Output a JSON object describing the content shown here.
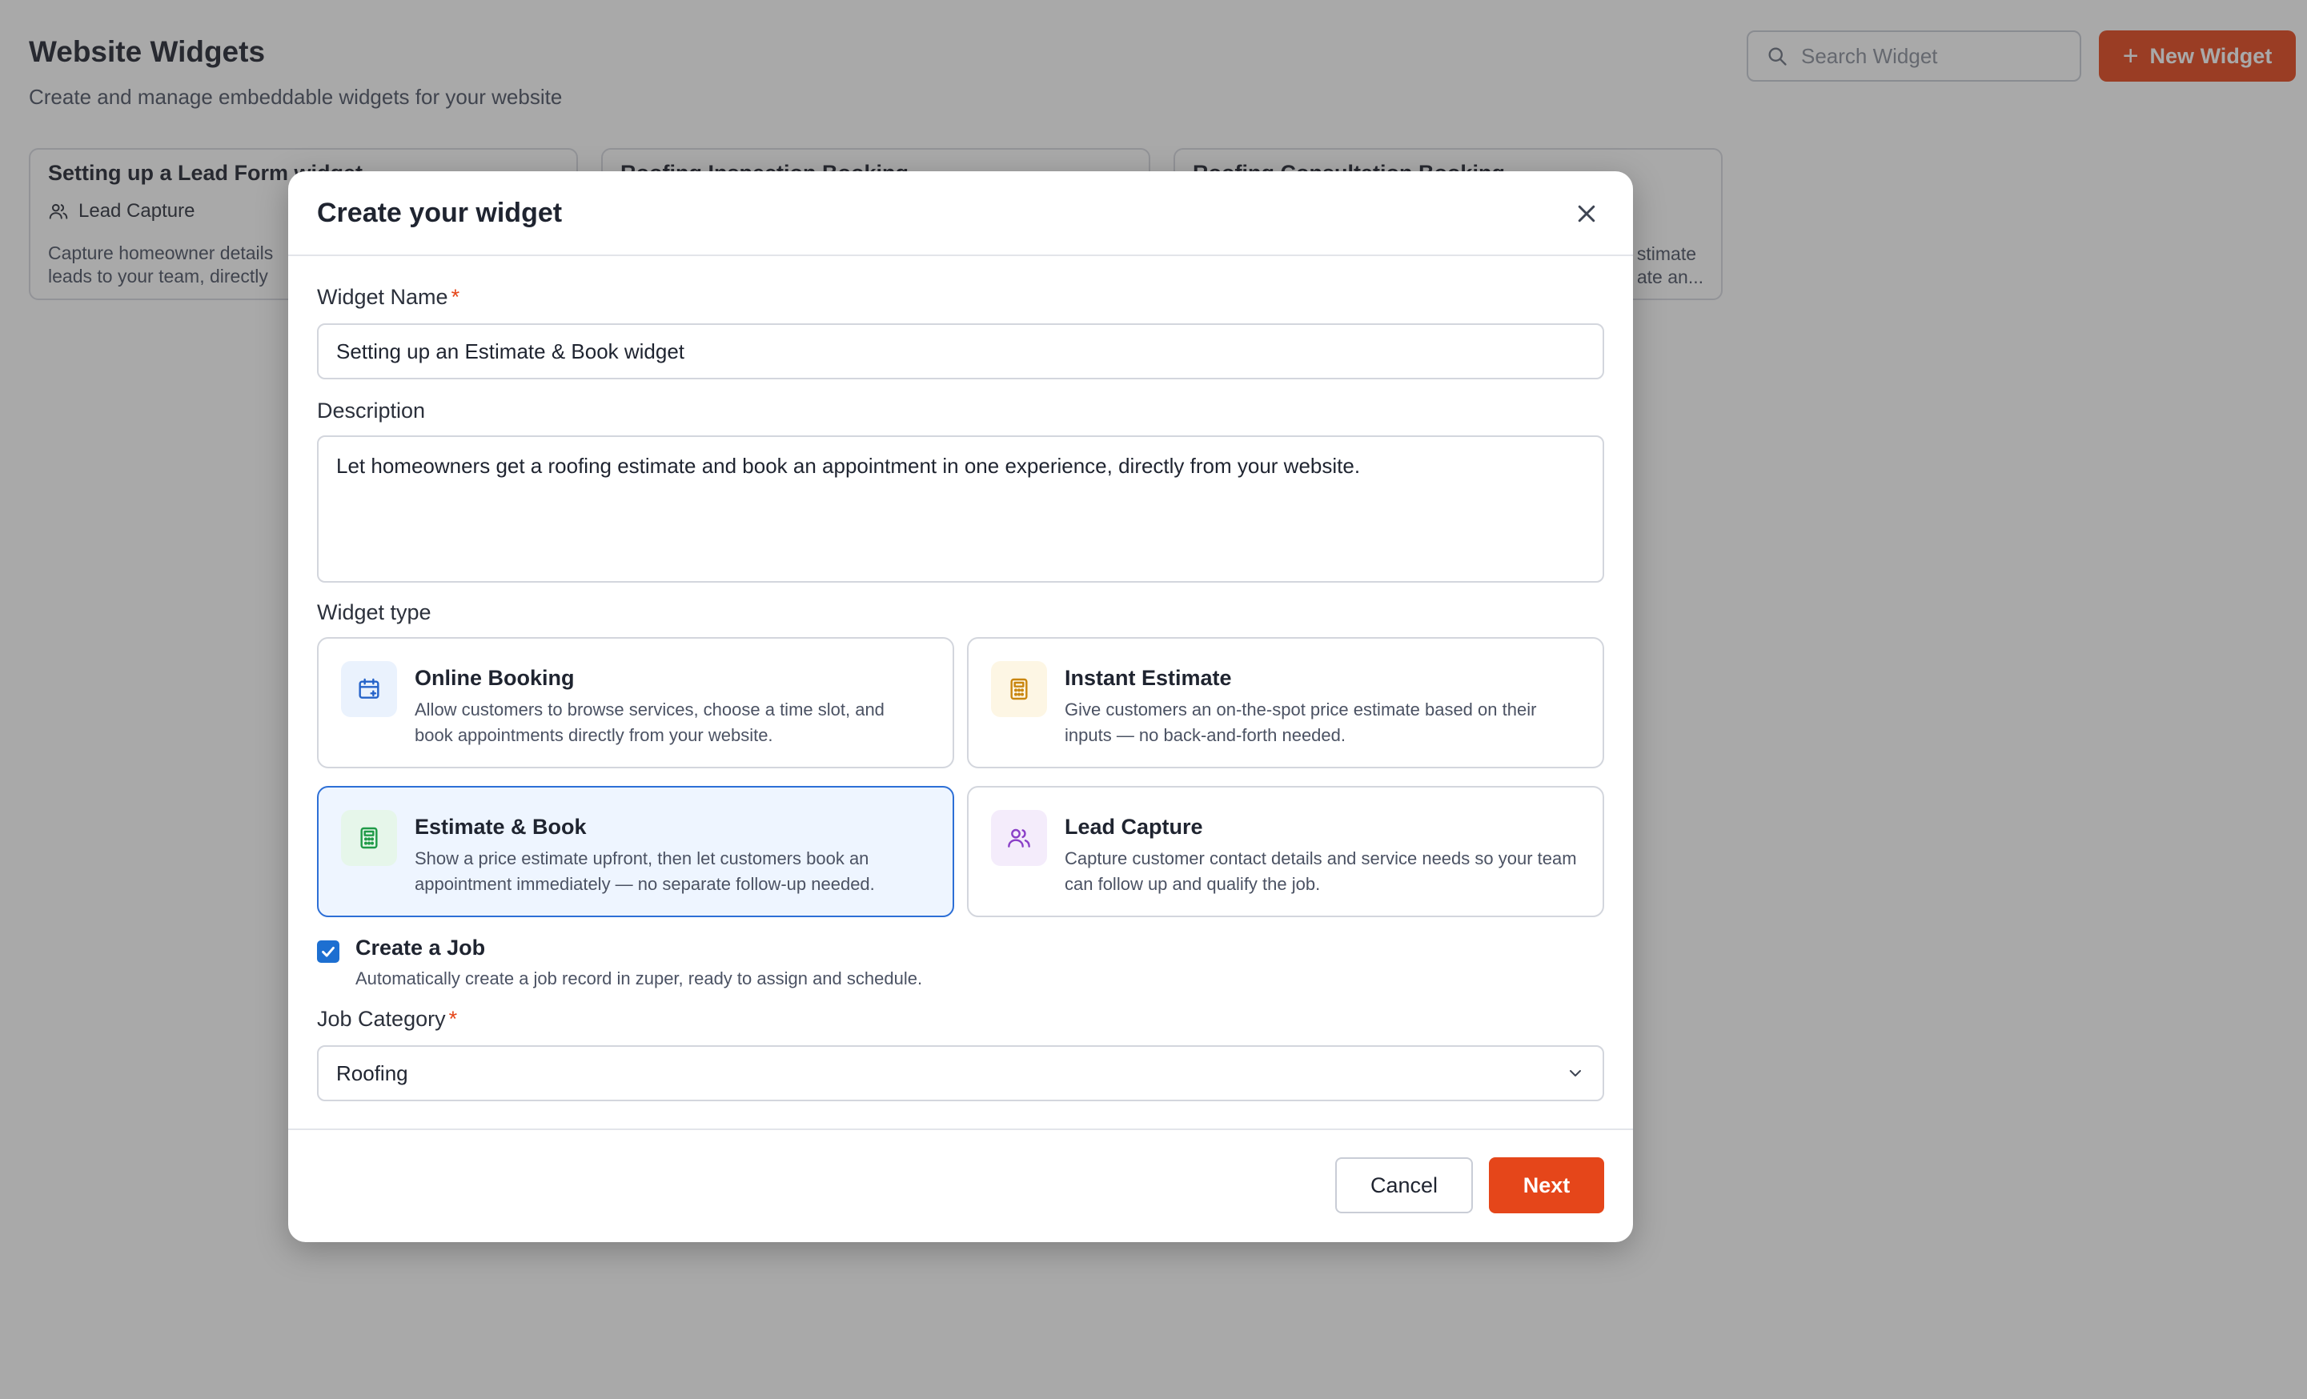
{
  "page": {
    "title": "Website Widgets",
    "subtitle": "Create and manage embeddable widgets for your website",
    "search_placeholder": "Search Widget",
    "new_widget_label": "New Widget",
    "cards": [
      {
        "title": "Setting up a Lead Form widget",
        "tag": "Lead Capture",
        "desc_line1": "Capture homeowner details",
        "desc_line2": "leads to your team, directly"
      },
      {
        "title": "Roofing Inspection Booking"
      },
      {
        "title": "Roofing Consultation Booking",
        "desc_line1": "stimate",
        "desc_line2": "ate an..."
      }
    ]
  },
  "modal": {
    "title": "Create your widget",
    "widget_name_label": "Widget Name",
    "required_mark": "*",
    "widget_name_value": "Setting up an Estimate & Book widget",
    "description_label": "Description",
    "description_value": "Let homeowners get a roofing estimate and book an appointment in one experience, directly from your website.",
    "widget_type_label": "Widget type",
    "widget_types": [
      {
        "name": "Online Booking",
        "desc": "Allow customers to browse services, choose a time slot, and book appointments directly from your website.",
        "icon": "calendar-icon",
        "selected": false
      },
      {
        "name": "Instant Estimate",
        "desc": "Give customers an on-the-spot price estimate based on their inputs — no back-and-forth needed.",
        "icon": "calculator-icon",
        "selected": false
      },
      {
        "name": "Estimate & Book",
        "desc": "Show a price estimate upfront, then let customers book an appointment immediately — no separate follow-up needed.",
        "icon": "calculator-icon",
        "selected": true
      },
      {
        "name": "Lead Capture",
        "desc": "Capture customer contact details and service needs so your team can follow up and qualify the job.",
        "icon": "users-icon",
        "selected": false
      }
    ],
    "create_job_label": "Create a Job",
    "create_job_desc": "Automatically create a job record in zuper, ready to assign and schedule.",
    "create_job_checked": true,
    "job_category_label": "Job Category",
    "job_category_value": "Roofing",
    "cancel_label": "Cancel",
    "next_label": "Next"
  },
  "colors": {
    "accent": "#e5461a",
    "selected_border": "#2d6fd6",
    "selected_bg": "#eef5ff",
    "checkbox": "#1d6fd1"
  }
}
